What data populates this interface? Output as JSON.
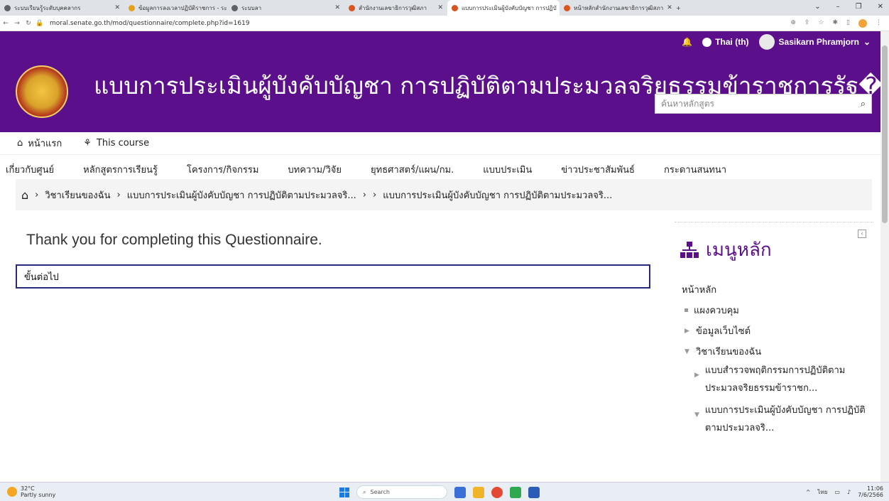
{
  "browser": {
    "tabs": [
      {
        "title": "ระบบเรียนรู้ระดับบุคคลากร",
        "active": false
      },
      {
        "title": "ข้อมูลการลงเวลาปฏิบัติราชการ - ระบบ",
        "active": false
      },
      {
        "title": "ระบบลา",
        "active": false
      },
      {
        "title": "สำนักงานเลขาธิการวุฒิสภา",
        "active": false
      },
      {
        "title": "แบบการประเมินผู้บังคับบัญชา การปฏิบั",
        "active": true
      },
      {
        "title": "หน้าหลักสำนักงานเลขาธิการวุฒิสภา",
        "active": false
      }
    ],
    "url": "moral.senate.go.th/mod/questionnaire/complete.php?id=1619"
  },
  "topnav": {
    "language": "Thai (th)",
    "user_name": "Sasikarn Phramjorn"
  },
  "header": {
    "site_title": "แบบการประเมินผู้บังคับบัญชา การปฏิบัติตามประมวลจริยธรรมข้าราชการรัฐ� ...",
    "search_placeholder": "ค้นหาหลักสูตร"
  },
  "subnav": {
    "home": "หน้าแรก",
    "this_course": "This course"
  },
  "mainmenu": [
    "เกี่ยวกับศูนย์",
    "หลักสูตรการเรียนรู้",
    "โครงการ/กิจกรรม",
    "บทความ/วิจัย",
    "ยุทธศาสตร์/แผน/กม.",
    "แบบประเมิน",
    "ข่าวประชาสัมพันธ์",
    "กระดานสนทนา"
  ],
  "breadcrumb": {
    "sep": "›",
    "items": [
      "วิชาเรียนของฉัน",
      "แบบการประเมินผู้บังคับบัญชา การปฏิบัติตามประมวลจริ...",
      "",
      "แบบการประเมินผู้บังคับบัญชา การปฏิบัติตามประมวลจริ..."
    ]
  },
  "main": {
    "thank_you": "Thank you for completing this Questionnaire.",
    "next_link": "ขั้นต่อไป"
  },
  "sidebar": {
    "title": "เมนูหลัก",
    "home": "หน้าหลัก",
    "dashboard": "แผงควบคุม",
    "site_info": "ข้อมูลเว็บไซต์",
    "my_courses": "วิชาเรียนของฉัน",
    "course1": "แบบสำรวจพฤติกรรมการปฏิบัติตามประมวลจริยธรรมข้าราชก...",
    "course2": "แบบการประเมินผู้บังคับบัญชา การปฏิบัติตามประมวลจริ..."
  },
  "taskbar": {
    "temperature": "32°C",
    "weather": "Partly sunny",
    "search": "Search",
    "ime": "ไทย",
    "time": "11:06",
    "date": "7/6/2566"
  },
  "colors": {
    "brand_purple": "#5b0f8a",
    "next_border": "#2a2a7a"
  }
}
